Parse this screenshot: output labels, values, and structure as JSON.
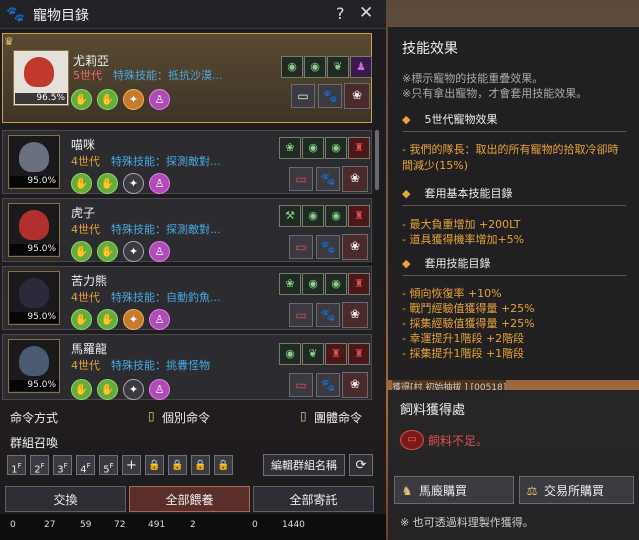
{
  "window": {
    "title": "寵物目錄",
    "help": "?",
    "close": "✕"
  },
  "pets": [
    {
      "name": "尤莉亞",
      "gen": "5世代",
      "skill": "特殊技能：抵抗沙漠...",
      "level": "96.5%"
    },
    {
      "name": "喵咪",
      "gen": "4世代",
      "skill": "特殊技能：探測敵對...",
      "level": "95.0%"
    },
    {
      "name": "虎子",
      "gen": "4世代",
      "skill": "特殊技能：探測敵對...",
      "level": "95.0%"
    },
    {
      "name": "苦力熊",
      "gen": "4世代",
      "skill": "特殊技能：自動釣魚...",
      "level": "95.0%"
    },
    {
      "name": "馬羅龍",
      "gen": "4世代",
      "skill": "特殊技能：挑釁怪物",
      "level": "95.0%"
    }
  ],
  "command": {
    "label": "命令方式",
    "individual": "個別命令",
    "group": "團體命令"
  },
  "group": {
    "title": "群組召喚",
    "buttons": [
      "1",
      "2",
      "3",
      "4",
      "5"
    ],
    "superscripts": [
      "F",
      "F",
      "F",
      "F",
      "F"
    ],
    "edit": "編輯群組名稱"
  },
  "actions": {
    "exchange": "交換",
    "feed_all": "全部餵養",
    "store_all": "全部寄託"
  },
  "hotbar": [
    "0",
    "27",
    "59",
    "72",
    "491",
    "2",
    "0",
    "1440"
  ],
  "skill_effects": {
    "title": "技能效果",
    "note1": "※標示寵物的技能重疊效果。",
    "note2": "※只有拿出寵物，才會套用技能效果。",
    "gen_header": "5世代寵物效果",
    "gen_line1": "- 我們的隊長：取出的所有寵物的拾取冷卻時",
    "gen_line2": "間減少(15%)",
    "basic_header": "套用基本技能目錄",
    "basic": [
      "- 最大負重增加 +200LT",
      "- 道具獲得機率增加+5%"
    ],
    "applied_header": "套用技能目錄",
    "applied": [
      "- 傾向恢復率 +10%",
      "- 戰鬥經驗值獲得量 +25%",
      "- 採集經驗值獲得量 +25%",
      "- 幸運提升1階段 +2階段",
      "- 採集提升1階段 +1階段"
    ]
  },
  "overlay": "獲得[村 初始抽拔 ] [00518]",
  "feed": {
    "title": "飼料獲得處",
    "status": "飼料不足。",
    "stable_buy": "馬廄購買",
    "market_buy": "交易所購買",
    "footer": "※   也可透過料理製作獲得。"
  }
}
